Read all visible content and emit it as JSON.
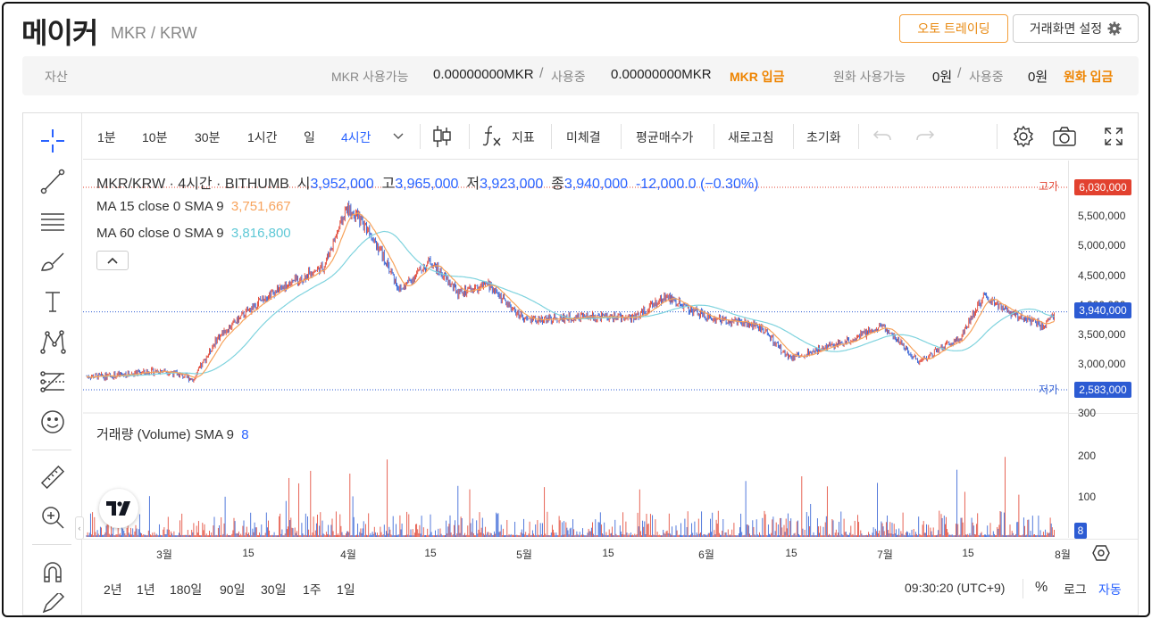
{
  "header": {
    "title": "메이커",
    "pair": "MKR / KRW",
    "auto_trading_label": "오토 트레이딩",
    "settings_label": "거래화면 설정"
  },
  "assets": {
    "label": "자산",
    "mkr_available_label": "MKR 사용가능",
    "mkr_available_value": "0.00000000MKR",
    "slash": "/",
    "in_use_label": "사용중",
    "mkr_in_use_value": "0.00000000MKR",
    "mkr_deposit_label": "MKR 입금",
    "krw_available_label": "원화 사용가능",
    "krw_available_value": "0원",
    "krw_in_use_value": "0원",
    "krw_deposit_label": "원화 입금"
  },
  "toolbar": {
    "intervals": [
      "1분",
      "10분",
      "30분",
      "1시간",
      "일",
      "4시간"
    ],
    "active_interval": "4시간",
    "indicators_label": "지표",
    "unfilled_label": "미체결",
    "avg_buy_label": "평균매수가",
    "refresh_label": "새로고침",
    "reset_label": "초기화"
  },
  "legend": {
    "symbol": "MKR/KRW · 4시간 · BITHUMB",
    "open_label": "시",
    "open": "3,952,000",
    "high_label": "고",
    "high": "3,965,000",
    "low_label": "저",
    "low": "3,923,000",
    "close_label": "종",
    "close": "3,940,000",
    "change": "-12,000.0 (−0.30%)",
    "ma15_label": "MA 15 close 0 SMA 9",
    "ma15_value": "3,751,667",
    "ma60_label": "MA 60 close 0 SMA 9",
    "ma60_value": "3,816,800",
    "volume_label": "거래량 (Volume) SMA 9",
    "volume_value": "8"
  },
  "price_axis": {
    "ticks": [
      "5,500,000",
      "5,000,000",
      "4,500,000",
      "4,000,000",
      "3,500,000",
      "3,000,000"
    ],
    "high_label": "고가",
    "high_value": "6,030,000",
    "current_value": "3,940,000",
    "low_label": "저가",
    "low_value": "2,583,000",
    "volume_ticks": [
      "300",
      "200",
      "100"
    ],
    "volume_current": "8"
  },
  "time_axis": {
    "ticks": [
      "3월",
      "15",
      "4월",
      "15",
      "5월",
      "15",
      "6월",
      "15",
      "7월",
      "15",
      "8월"
    ]
  },
  "bottom_bar": {
    "ranges": [
      "2년",
      "1년",
      "180일",
      "90일",
      "30일",
      "1주",
      "1일"
    ],
    "clock": "09:30:20 (UTC+9)",
    "percent_label": "%",
    "log_label": "로그",
    "auto_label": "자동"
  },
  "colors": {
    "up": "#e2412f",
    "down": "#2c5bd3",
    "ma15": "#f7a35c",
    "ma60": "#7fd3de",
    "accent": "#2962ff",
    "brand": "#f08300"
  },
  "chart_data": {
    "type": "candlestick",
    "symbol": "MKR/KRW",
    "interval": "4시간",
    "exchange": "BITHUMB",
    "x_ticks": [
      "3월",
      "15",
      "4월",
      "15",
      "5월",
      "15",
      "6월",
      "15",
      "7월",
      "15",
      "8월"
    ],
    "y_ticks": [
      5500000,
      5000000,
      4500000,
      4000000,
      3500000,
      3000000
    ],
    "high_marker": 6030000,
    "low_marker": 2583000,
    "last_price": 3940000,
    "ohlc_last": {
      "open": 3952000,
      "high": 3965000,
      "low": 3923000,
      "close": 3940000
    },
    "approx_price_path": [
      {
        "x": "02-20",
        "y": 2850000
      },
      {
        "x": "03-01",
        "y": 2950000
      },
      {
        "x": "03-06",
        "y": 2800000
      },
      {
        "x": "03-10",
        "y": 3500000
      },
      {
        "x": "03-18",
        "y": 4200000
      },
      {
        "x": "03-28",
        "y": 4700000
      },
      {
        "x": "04-01",
        "y": 5700000
      },
      {
        "x": "04-05",
        "y": 5300000
      },
      {
        "x": "04-10",
        "y": 4300000
      },
      {
        "x": "04-15",
        "y": 4800000
      },
      {
        "x": "04-20",
        "y": 4250000
      },
      {
        "x": "04-25",
        "y": 4400000
      },
      {
        "x": "05-01",
        "y": 3800000
      },
      {
        "x": "05-10",
        "y": 3850000
      },
      {
        "x": "05-20",
        "y": 3850000
      },
      {
        "x": "05-25",
        "y": 4200000
      },
      {
        "x": "06-01",
        "y": 3850000
      },
      {
        "x": "06-10",
        "y": 3700000
      },
      {
        "x": "06-15",
        "y": 3150000
      },
      {
        "x": "06-25",
        "y": 3450000
      },
      {
        "x": "07-01",
        "y": 3700000
      },
      {
        "x": "07-07",
        "y": 3100000
      },
      {
        "x": "07-14",
        "y": 3500000
      },
      {
        "x": "07-18",
        "y": 4200000
      },
      {
        "x": "07-22",
        "y": 3950000
      },
      {
        "x": "07-28",
        "y": 3700000
      },
      {
        "x": "07-31",
        "y": 3940000
      }
    ],
    "moving_averages": [
      {
        "name": "MA 15 close 0 SMA 9",
        "last": 3751667
      },
      {
        "name": "MA 60 close 0 SMA 9",
        "last": 3816800
      }
    ],
    "volume": {
      "y_ticks": [
        300,
        200,
        100
      ],
      "last": 8,
      "sma_label": "SMA 9"
    }
  }
}
